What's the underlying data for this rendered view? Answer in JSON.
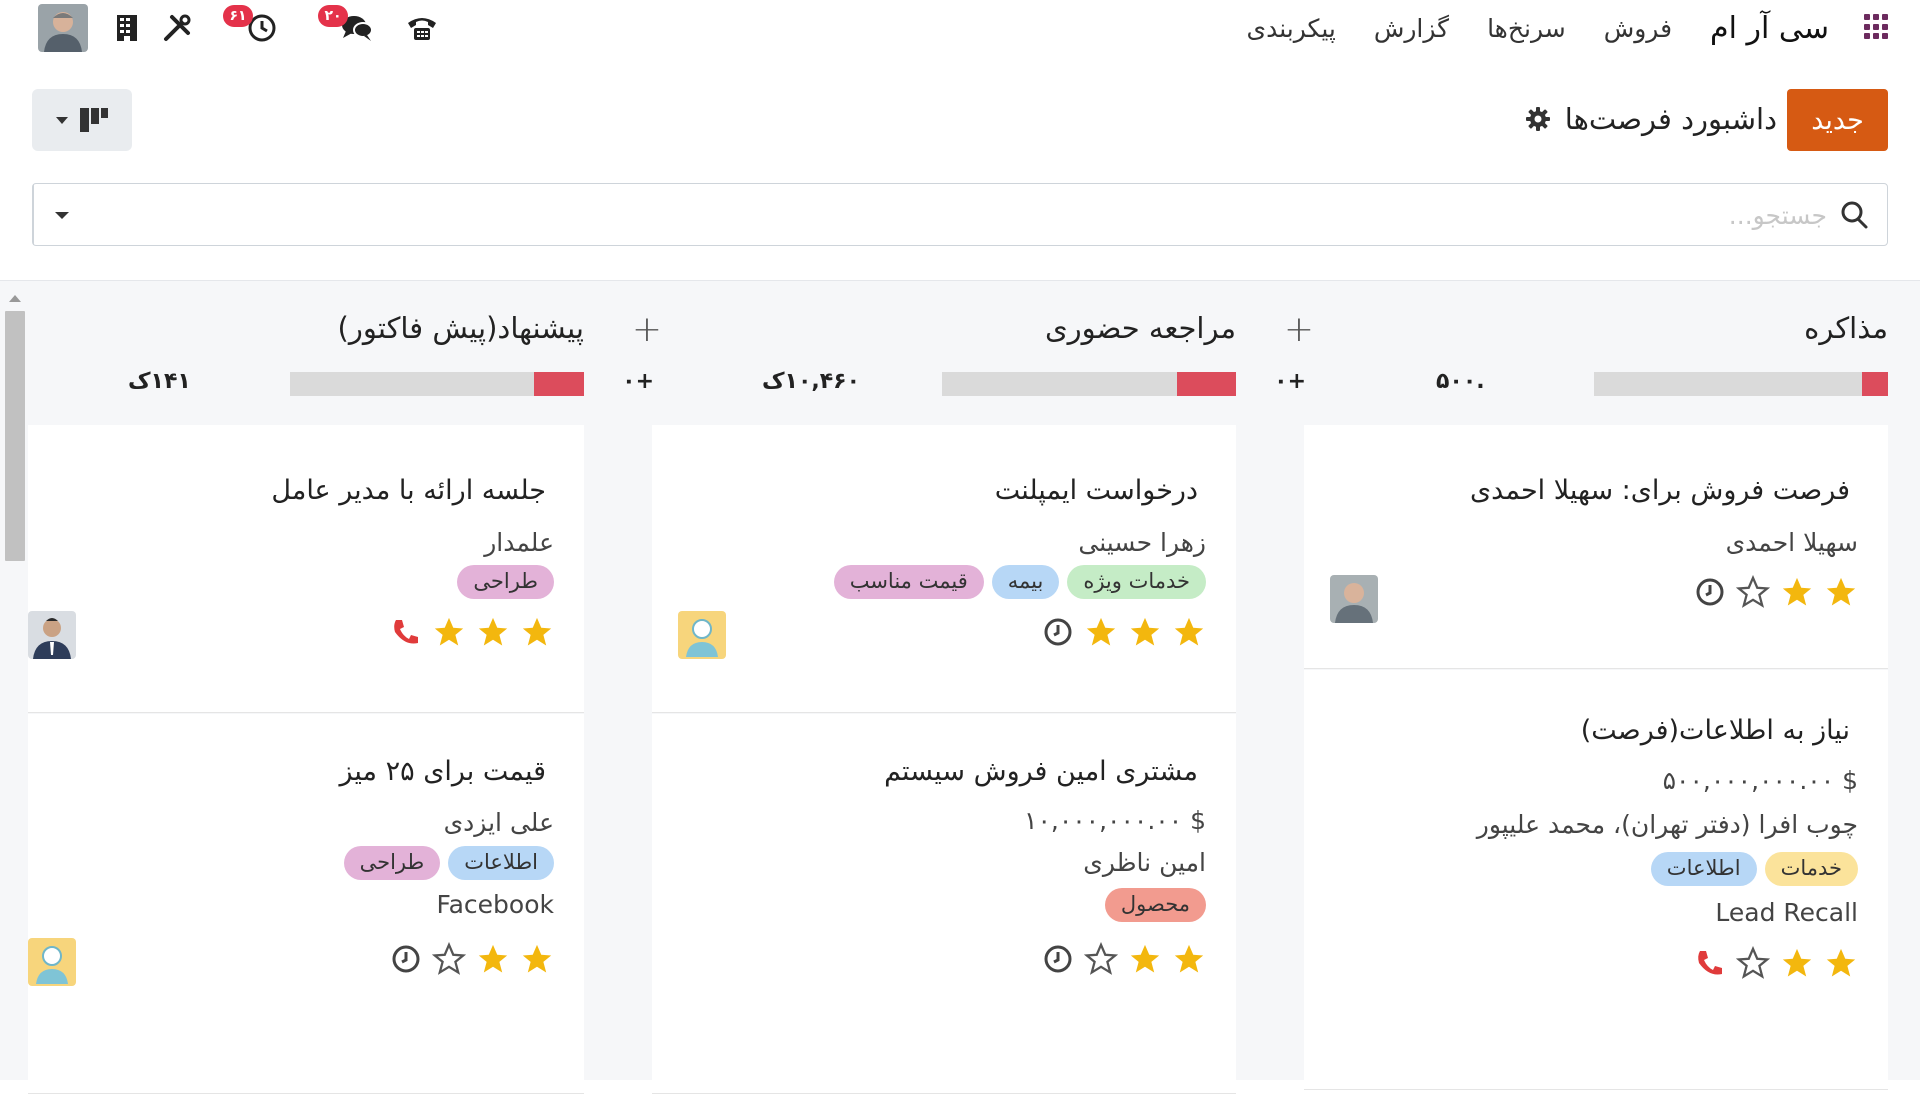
{
  "navbar": {
    "brand": "سی آر ام",
    "menu": [
      "فروش",
      "سرنخ‌ها",
      "گزارش",
      "پیکربندی"
    ],
    "activity_badge": "۶۱",
    "messages_badge": "۲۰"
  },
  "control": {
    "new_button": "جدید",
    "page_title": "داشبورد فرصت‌ها"
  },
  "search": {
    "placeholder": "جستجو..."
  },
  "colors": {
    "accent": "#d65a13",
    "progress_red": "#dc4c5c",
    "star": "#f3b70e"
  },
  "columns": [
    {
      "title": "مذاکره",
      "total": ".۵۰۰",
      "extra": "",
      "progress_red_fraction": 0.09,
      "cards": [
        {
          "title": "فرصت فروش برای: سهیلا احمدی",
          "lines": [
            "سهیلا احمدی"
          ],
          "tags": [],
          "stars": 2,
          "activity": "clock-icon",
          "avatar": "photo-man"
        },
        {
          "title": "نیاز به اطلاعات(فرصت)",
          "lines": [
            "$ ۵۰۰,۰۰۰,۰۰۰.۰۰",
            "چوب افرا (دفتر تهران)، محمد علیپور"
          ],
          "tags": [
            {
              "label": "خدمات",
              "color": "yellow"
            },
            {
              "label": "اطلاعات",
              "color": "blue"
            }
          ],
          "source": "Lead Recall",
          "stars": 2,
          "activity": "phone-icon",
          "avatar": ""
        }
      ]
    },
    {
      "title": "مراجعه حضوری",
      "total": "۱۰,۴۶۰ک",
      "extra": "+۰",
      "progress_red_fraction": 0.2,
      "cards": [
        {
          "title": "درخواست ایمپلنت",
          "lines": [
            "زهرا حسینی"
          ],
          "tags": [
            {
              "label": "خدمات ویژه",
              "color": "green"
            },
            {
              "label": "بیمه",
              "color": "blue"
            },
            {
              "label": "قیمت مناسب",
              "color": "purple"
            }
          ],
          "stars": 3,
          "activity": "clock-icon",
          "avatar": "default-avatar"
        },
        {
          "title": "مشتری امین فروش سیستم",
          "lines": [
            "$ ۱۰,۰۰۰,۰۰۰.۰۰",
            "امین ناظری"
          ],
          "tags": [
            {
              "label": "محصول",
              "color": "red"
            }
          ],
          "stars": 2,
          "activity": "clock-icon",
          "avatar": ""
        }
      ]
    },
    {
      "title": "پیشنهاد(پیش فاکتور)",
      "total": "۱۴۱ک",
      "extra": "+۰",
      "progress_red_fraction": 0.17,
      "cards": [
        {
          "title": "جلسه ارائه با مدیر عامل",
          "lines": [
            "علمدار"
          ],
          "tags": [
            {
              "label": "طراحی",
              "color": "purple"
            }
          ],
          "stars": 3,
          "activity": "phone-icon",
          "avatar": "photo-man-suit"
        },
        {
          "title": "قیمت برای ۲۵ میز",
          "lines": [
            "علی ایزدی"
          ],
          "tags": [
            {
              "label": "اطلاعات",
              "color": "blue"
            },
            {
              "label": "طراحی",
              "color": "purple"
            }
          ],
          "source": "Facebook",
          "stars": 2,
          "activity": "clock-icon",
          "avatar": "default-avatar"
        }
      ]
    }
  ]
}
